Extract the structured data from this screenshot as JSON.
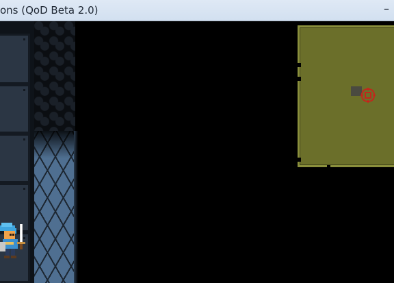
{
  "window": {
    "title": "ons (QoD Beta 2.0)",
    "minimize_glyph": "–"
  },
  "game": {
    "hero": {
      "class": "warrior",
      "icon": "sword"
    },
    "minimap": {
      "player_marker_icon": "target-icon"
    }
  },
  "colors": {
    "wall": "#2b3644",
    "lit_floor": "#4f6f91",
    "minimap_bg": "#6b6f2a",
    "minimap_border": "#8a8f3c",
    "marker": "#c0281c",
    "hero_hair": "#3fa6e0",
    "hero_skin": "#f0a24a"
  }
}
